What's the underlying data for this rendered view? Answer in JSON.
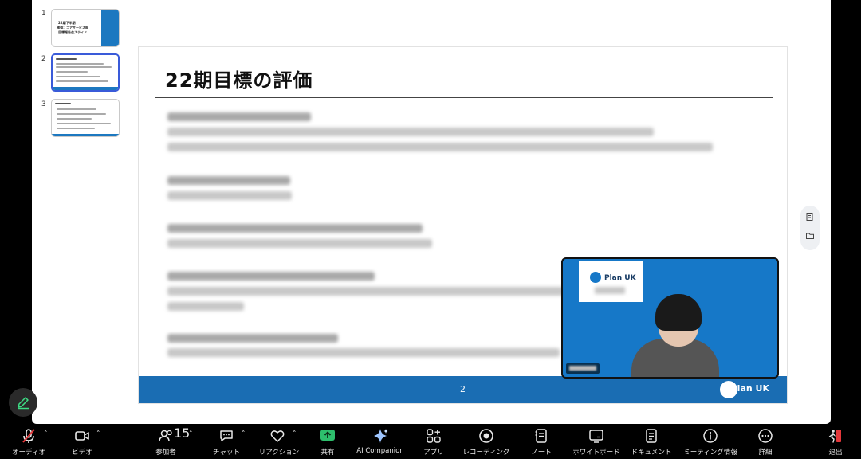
{
  "thumbnails": [
    {
      "number": "1",
      "title_lines": [
        "22期下半期",
        "横須：コアサービス部",
        "目標報告会スライド"
      ]
    },
    {
      "number": "2"
    },
    {
      "number": "3"
    }
  ],
  "slide": {
    "title": "22期目標の評価",
    "page_number": "2",
    "footer_brand": "Plan UK"
  },
  "video": {
    "brand": "Plan UK"
  },
  "toolbar": {
    "audio": "オーディオ",
    "video": "ビデオ",
    "participants": "参加者",
    "participants_count": "15",
    "chat": "チャット",
    "reactions": "リアクション",
    "share": "共有",
    "ai_companion": "AI Companion",
    "apps": "アプリ",
    "recording": "レコーディング",
    "notes": "ノート",
    "whiteboard": "ホワイトボード",
    "docs": "ドキュメント",
    "meeting_info": "ミーティング情報",
    "more": "詳細",
    "leave": "退出"
  },
  "colors": {
    "slide_footer": "#1a6db3",
    "share_green": "#2dbe6c",
    "leave_red": "#e5383b",
    "thumb_active_border": "#3a5bd9"
  }
}
